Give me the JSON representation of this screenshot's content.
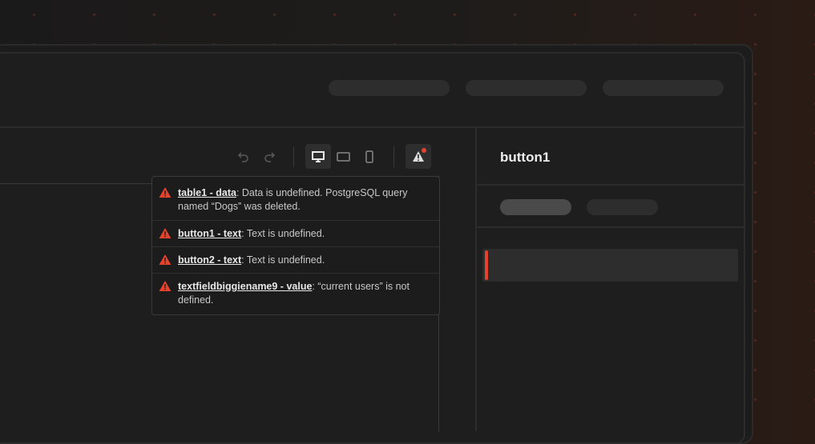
{
  "inspector": {
    "component_name": "button1"
  },
  "errors": [
    {
      "key": "table1 - data",
      "message": ": Data is undefined. PostgreSQL query named “Dogs” was deleted."
    },
    {
      "key": "button1 - text",
      "message": ": Text is undefined."
    },
    {
      "key": "button2 - text",
      "message": ": Text is undefined."
    },
    {
      "key": "textfieldbiggiename9 - value",
      "message": ":  “current users” is not defined."
    }
  ],
  "colors": {
    "error": "#e5432e",
    "background": "#1e1e1e"
  }
}
